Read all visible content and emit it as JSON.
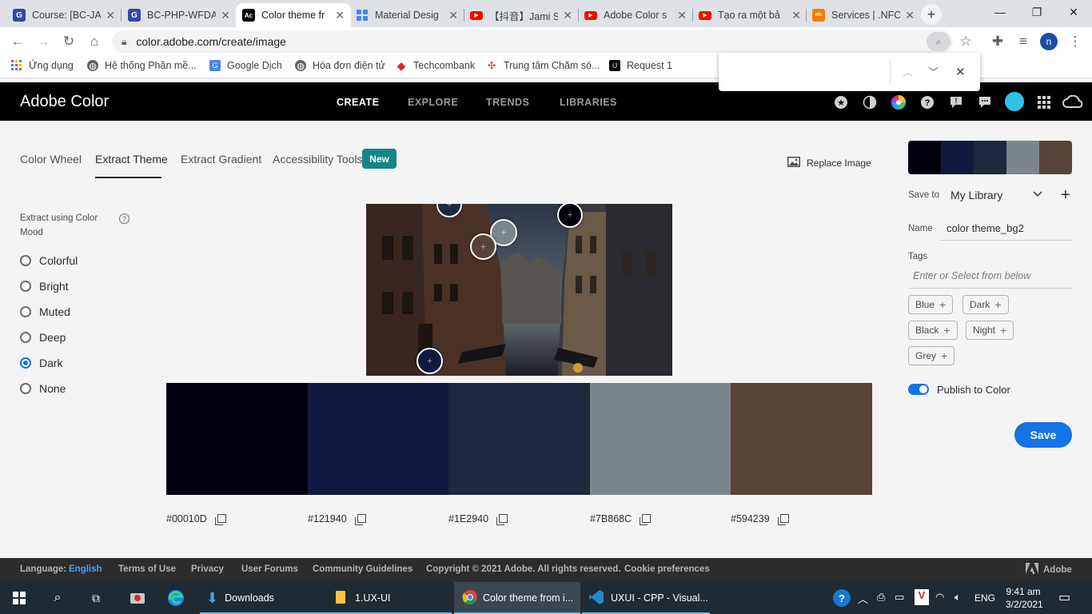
{
  "browser": {
    "tabs": [
      {
        "title": "Course: [BC-JA",
        "favicon": "G",
        "favicon_color": "#3049a8"
      },
      {
        "title": "BC-PHP-WFDA",
        "favicon": "G",
        "favicon_color": "#3049a8"
      },
      {
        "title": "Color theme fr",
        "favicon": "Ac",
        "favicon_color": "#000000"
      },
      {
        "title": "Material Desig",
        "favicon": "grid-icon",
        "favicon_color": "#4285f4"
      },
      {
        "title": "【抖音】Jami So",
        "favicon": "youtube-icon",
        "favicon_color": "#ff0000"
      },
      {
        "title": "Adobe Color s",
        "favicon": "youtube-icon",
        "favicon_color": "#ff0000"
      },
      {
        "title": "Tạo ra một bả",
        "favicon": "youtube-icon",
        "favicon_color": "#ff0000"
      },
      {
        "title": "Services | .NFC",
        "favicon": "nfc-icon",
        "favicon_color": "#f57c00"
      }
    ],
    "url": "color.adobe.com/create/image",
    "profile_initial": "n",
    "bookmarks": [
      {
        "label": "Ứng dụng",
        "icon": "apps-grid-icon"
      },
      {
        "label": "Hệ thống Phần mề...",
        "icon": "globe-icon"
      },
      {
        "label": "Google Dịch",
        "icon": "translate-icon"
      },
      {
        "label": "Hóa đơn điện tử",
        "icon": "globe-icon"
      },
      {
        "label": "Techcombank",
        "icon": "techcombank-icon"
      },
      {
        "label": "Trung tâm Chăm só...",
        "icon": "evn-icon"
      },
      {
        "label": "Request 1",
        "icon": "intellij-icon"
      }
    ]
  },
  "adobe": {
    "brand": "Adobe Color",
    "nav": [
      "CREATE",
      "EXPLORE",
      "TRENDS",
      "LIBRARIES"
    ],
    "subtabs": [
      "Color Wheel",
      "Extract Theme",
      "Extract Gradient",
      "Accessibility Tools"
    ],
    "new_badge": "New",
    "replace_image": "Replace Image",
    "mood_label": "Extract using Color Mood",
    "moods": [
      "Colorful",
      "Bright",
      "Muted",
      "Deep",
      "Dark",
      "None"
    ],
    "selected_mood": "Dark",
    "swatches": [
      {
        "hex": "#00010D",
        "color": "#00010D"
      },
      {
        "hex": "#121940",
        "color": "#121940"
      },
      {
        "hex": "#1E2940",
        "color": "#1E2940"
      },
      {
        "hex": "#7B868C",
        "color": "#7B868C"
      },
      {
        "hex": "#594239",
        "color": "#594239"
      }
    ],
    "save_to_label": "Save to",
    "library": "My Library",
    "name_label": "Name",
    "theme_name": "color theme_bg2",
    "tags_label": "Tags",
    "tags_placeholder": "Enter or Select from below",
    "tags": [
      "Blue",
      "Dark",
      "Black",
      "Night",
      "Grey"
    ],
    "publish_label": "Publish to Color",
    "save_button": "Save"
  },
  "footer": {
    "language_label": "Language:",
    "language": "English",
    "links": [
      "Terms of Use",
      "Privacy",
      "User Forums",
      "Community Guidelines"
    ],
    "copyright": "Copyright © 2021 Adobe. All rights reserved.",
    "cookie": "Cookie preferences",
    "adobe": "Adobe"
  },
  "taskbar": {
    "items": [
      "Downloads",
      "1.UX-UI",
      "Color theme from i...",
      "UXUI - CPP - Visual..."
    ],
    "lang": "ENG",
    "time": "9:41 am",
    "date": "3/2/2021"
  }
}
